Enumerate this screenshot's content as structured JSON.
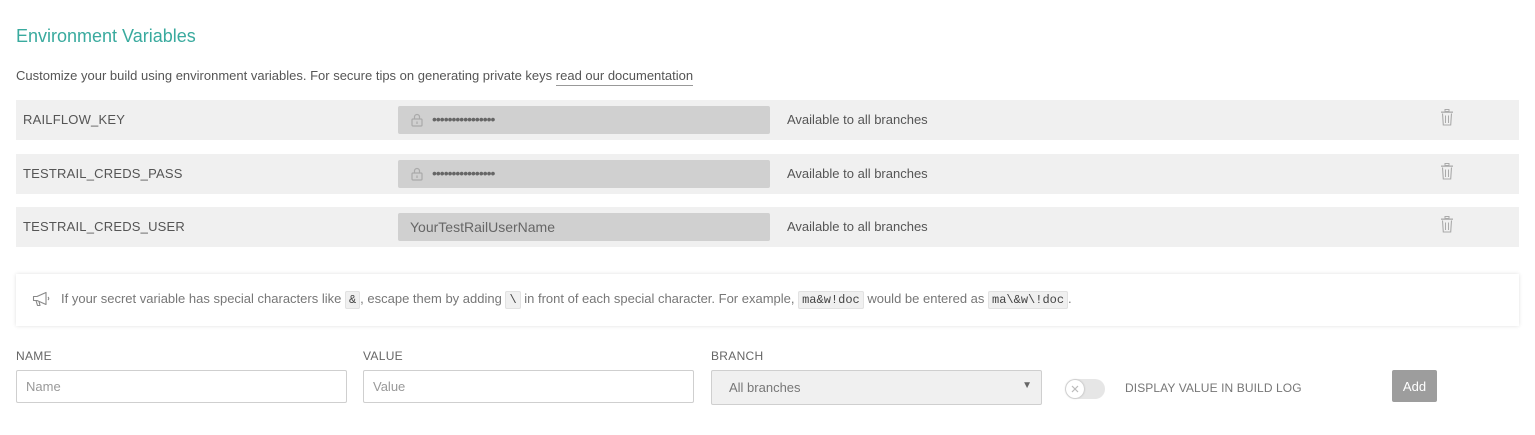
{
  "section": {
    "title": "Environment Variables",
    "description": "Customize your build using environment variables. For secure tips on generating private keys ",
    "doc_link": "read our documentation"
  },
  "env_vars": [
    {
      "name": "RAILFLOW_KEY",
      "value_masked": "••••••••••••••••",
      "secure": true,
      "branch": "Available to all branches"
    },
    {
      "name": "TESTRAIL_CREDS_PASS",
      "value_masked": "••••••••••••••••",
      "secure": true,
      "branch": "Available to all branches"
    },
    {
      "name": "TESTRAIL_CREDS_USER",
      "value_plain": "YourTestRailUserName",
      "secure": false,
      "branch": "Available to all branches"
    }
  ],
  "notice": {
    "part1": "If your secret variable has special characters like ",
    "code1": "&",
    "part2": ", escape them by adding ",
    "code2": "\\",
    "part3": " in front of each special character. For example, ",
    "code3": "ma&w!doc",
    "part4": " would be entered as ",
    "code4": "ma\\&w\\!doc",
    "part5": "."
  },
  "form": {
    "name_label": "NAME",
    "name_placeholder": "Name",
    "value_label": "VALUE",
    "value_placeholder": "Value",
    "branch_label": "BRANCH",
    "branch_selected": "All branches",
    "display_toggle_label": "DISPLAY VALUE IN BUILD LOG",
    "display_toggle_on": false,
    "add_label": "Add"
  },
  "icons": {
    "lock": "lock-icon",
    "trash": "trash-icon",
    "megaphone": "megaphone-icon",
    "caret": "caret-down-icon",
    "toggle_off": "x-icon"
  },
  "colors": {
    "title": "#39aa9e",
    "row_bg": "#f0f0f0",
    "masked_bg": "#d0d0d0",
    "add_button": "#9d9d9d"
  }
}
